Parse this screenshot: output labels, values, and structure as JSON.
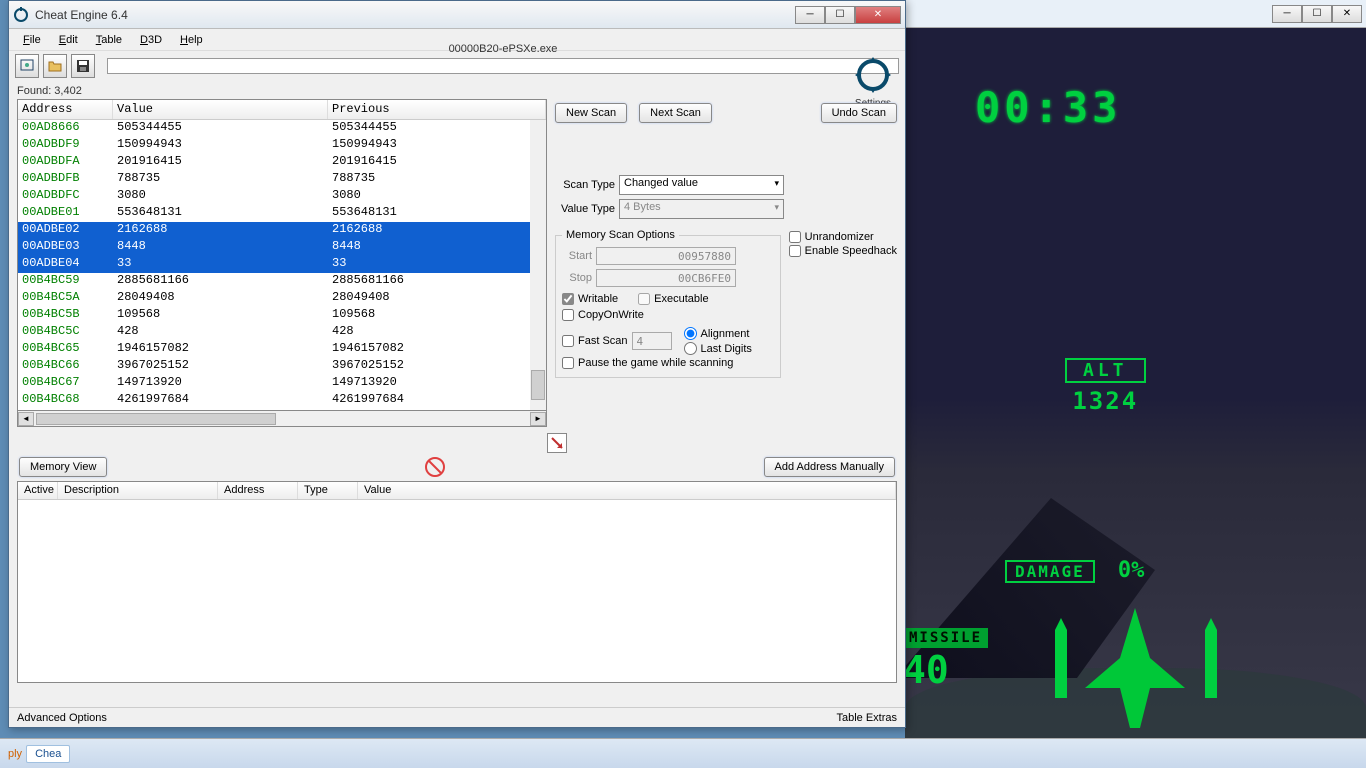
{
  "bg_tabs": [
    "",
    "",
    ""
  ],
  "game": {
    "timer": "00:33",
    "alt_label": "ALT",
    "alt_value": "1324",
    "damage_label": "DAMAGE",
    "damage_value": "0%",
    "missile_label": "MISSILE",
    "missile_value": "40"
  },
  "ce": {
    "title": "Cheat Engine 6.4",
    "menus": [
      "File",
      "Edit",
      "Table",
      "D3D",
      "Help"
    ],
    "process": "00000B20-ePSXe.exe",
    "settings_label": "Settings",
    "found": "Found: 3,402",
    "columns": {
      "address": "Address",
      "value": "Value",
      "previous": "Previous"
    },
    "rows": [
      {
        "addr": "00AD8666",
        "val": "505344455",
        "prev": "505344455",
        "sel": false
      },
      {
        "addr": "00ADBDF9",
        "val": "150994943",
        "prev": "150994943",
        "sel": false
      },
      {
        "addr": "00ADBDFA",
        "val": "201916415",
        "prev": "201916415",
        "sel": false
      },
      {
        "addr": "00ADBDFB",
        "val": "788735",
        "prev": "788735",
        "sel": false
      },
      {
        "addr": "00ADBDFC",
        "val": "3080",
        "prev": "3080",
        "sel": false
      },
      {
        "addr": "00ADBE01",
        "val": "553648131",
        "prev": "553648131",
        "sel": false
      },
      {
        "addr": "00ADBE02",
        "val": "2162688",
        "prev": "2162688",
        "sel": true
      },
      {
        "addr": "00ADBE03",
        "val": "8448",
        "prev": "8448",
        "sel": true
      },
      {
        "addr": "00ADBE04",
        "val": "33",
        "prev": "33",
        "sel": true
      },
      {
        "addr": "00B4BC59",
        "val": "2885681166",
        "prev": "2885681166",
        "sel": false
      },
      {
        "addr": "00B4BC5A",
        "val": "28049408",
        "prev": "28049408",
        "sel": false
      },
      {
        "addr": "00B4BC5B",
        "val": "109568",
        "prev": "109568",
        "sel": false
      },
      {
        "addr": "00B4BC5C",
        "val": "428",
        "prev": "428",
        "sel": false
      },
      {
        "addr": "00B4BC65",
        "val": "1946157082",
        "prev": "1946157082",
        "sel": false
      },
      {
        "addr": "00B4BC66",
        "val": "3967025152",
        "prev": "3967025152",
        "sel": false
      },
      {
        "addr": "00B4BC67",
        "val": "149713920",
        "prev": "149713920",
        "sel": false
      },
      {
        "addr": "00B4BC68",
        "val": "4261997684",
        "prev": "4261997684",
        "sel": false
      }
    ],
    "buttons": {
      "new_scan": "New Scan",
      "next_scan": "Next Scan",
      "undo_scan": "Undo Scan",
      "memory_view": "Memory View",
      "add_manually": "Add Address Manually"
    },
    "scan": {
      "scan_type_label": "Scan Type",
      "scan_type_value": "Changed value",
      "value_type_label": "Value Type",
      "value_type_value": "4 Bytes",
      "mem_opts_title": "Memory Scan Options",
      "start_label": "Start",
      "start_value": "00957880",
      "stop_label": "Stop",
      "stop_value": "00CB6FE0",
      "writable": "Writable",
      "executable": "Executable",
      "copyonwrite": "CopyOnWrite",
      "fast_scan": "Fast Scan",
      "fast_scan_value": "4",
      "alignment": "Alignment",
      "last_digits": "Last Digits",
      "pause_scan": "Pause the game while scanning",
      "unrandomizer": "Unrandomizer",
      "speedhack": "Enable Speedhack"
    },
    "addrlist_columns": {
      "active": "Active",
      "description": "Description",
      "address": "Address",
      "type": "Type",
      "value": "Value"
    },
    "status": {
      "left": "Advanced Options",
      "right": "Table Extras"
    }
  },
  "taskbar": {
    "item1": "ply",
    "item2": "Chea"
  }
}
